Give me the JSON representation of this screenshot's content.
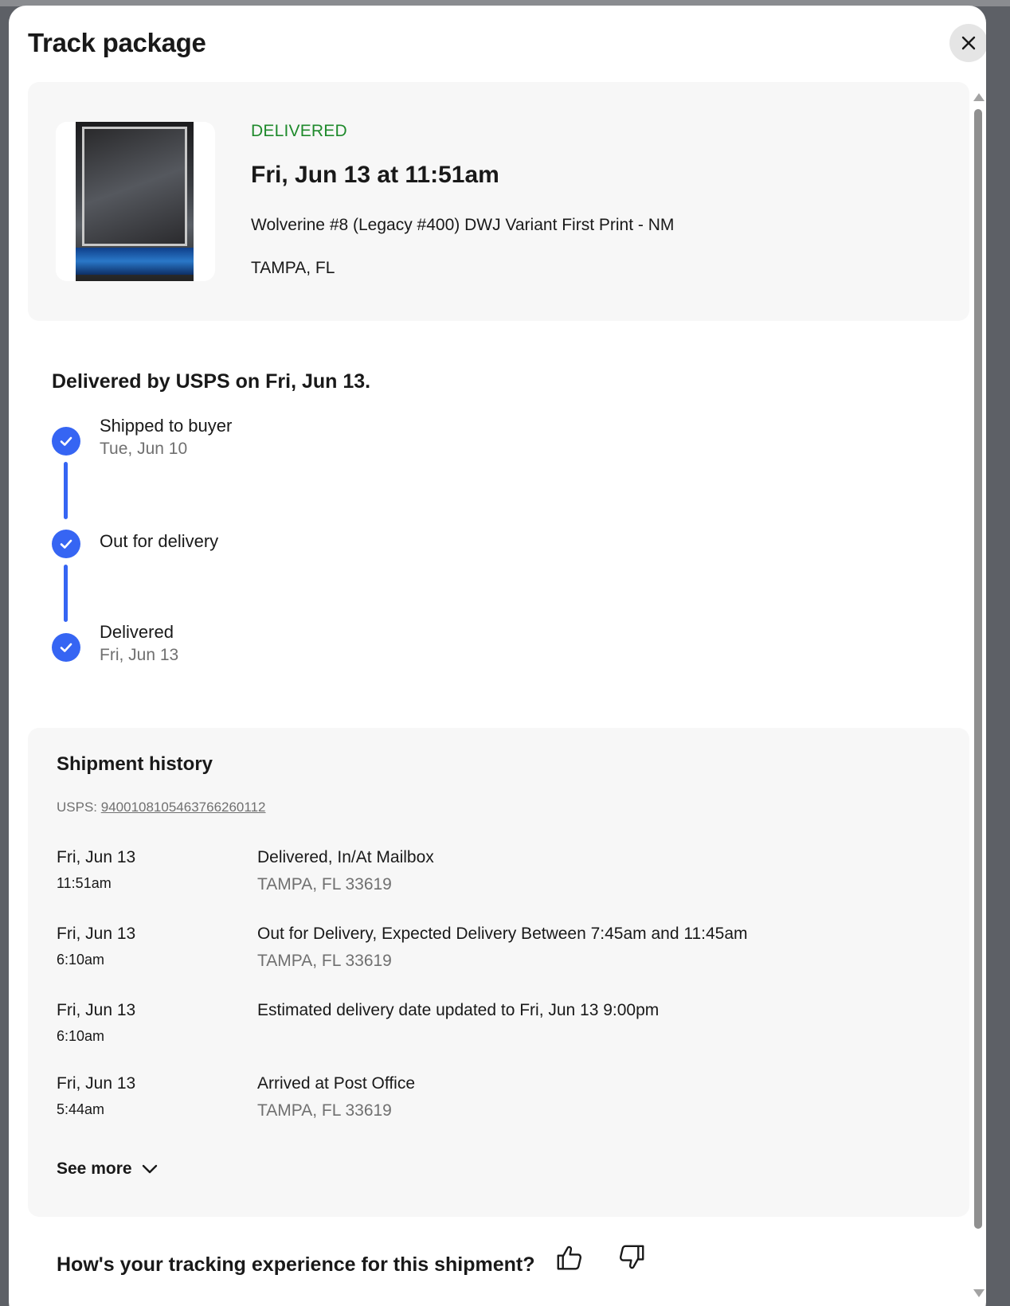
{
  "modal": {
    "title": "Track package",
    "close_label": "Close"
  },
  "summary": {
    "status": "DELIVERED",
    "delivery_datetime": "Fri, Jun 13 at 11:51am",
    "item_title": "Wolverine #8 (Legacy #400) DWJ Variant First Print - NM",
    "location": "TAMPA, FL",
    "status_color": "#1f8a2c"
  },
  "progress": {
    "headline": "Delivered by USPS on Fri, Jun 13.",
    "accent_color": "#3665f3",
    "steps": [
      {
        "label": "Shipped to buyer",
        "date": "Tue, Jun 10",
        "icon": "check-icon"
      },
      {
        "label": "Out for delivery",
        "date": "",
        "icon": "check-icon"
      },
      {
        "label": "Delivered",
        "date": "Fri, Jun 13",
        "icon": "check-icon"
      }
    ]
  },
  "history": {
    "title": "Shipment history",
    "carrier_prefix": "USPS: ",
    "tracking_number": "9400108105463766260112",
    "events": [
      {
        "date": "Fri, Jun 13",
        "time": "11:51am",
        "description": "Delivered, In/At Mailbox",
        "location": "TAMPA, FL 33619"
      },
      {
        "date": "Fri, Jun 13",
        "time": "6:10am",
        "description": "Out for Delivery, Expected Delivery Between 7:45am and 11:45am",
        "location": "TAMPA, FL 33619"
      },
      {
        "date": "Fri, Jun 13",
        "time": "6:10am",
        "description": "Estimated delivery date updated to Fri, Jun 13 9:00pm",
        "location": ""
      },
      {
        "date": "Fri, Jun 13",
        "time": "5:44am",
        "description": "Arrived at Post Office",
        "location": "TAMPA, FL 33619"
      }
    ],
    "see_more_label": "See more"
  },
  "feedback": {
    "question": "How's your tracking experience for this shipment?",
    "thumbs_up_icon": "thumbs-up-icon",
    "thumbs_down_icon": "thumbs-down-icon"
  }
}
